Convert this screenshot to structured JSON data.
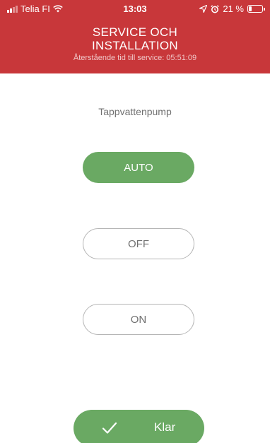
{
  "status_bar": {
    "carrier": "Telia FI",
    "time": "13:03",
    "battery_percent": "21 %",
    "battery_level": 0.21
  },
  "header": {
    "title_line1": "SERVICE OCH",
    "title_line2": "INSTALLATION",
    "subtitle": "Återstående tid till service: 05:51:09",
    "background_color": "#c8373a"
  },
  "section_label": "Tappvattenpump",
  "modes": {
    "selected": "AUTO",
    "auto_label": "AUTO",
    "off_label": "OFF",
    "on_label": "ON"
  },
  "done_button": {
    "label": "Klar",
    "icon": "checkmark-icon",
    "color": "#6aa963"
  }
}
